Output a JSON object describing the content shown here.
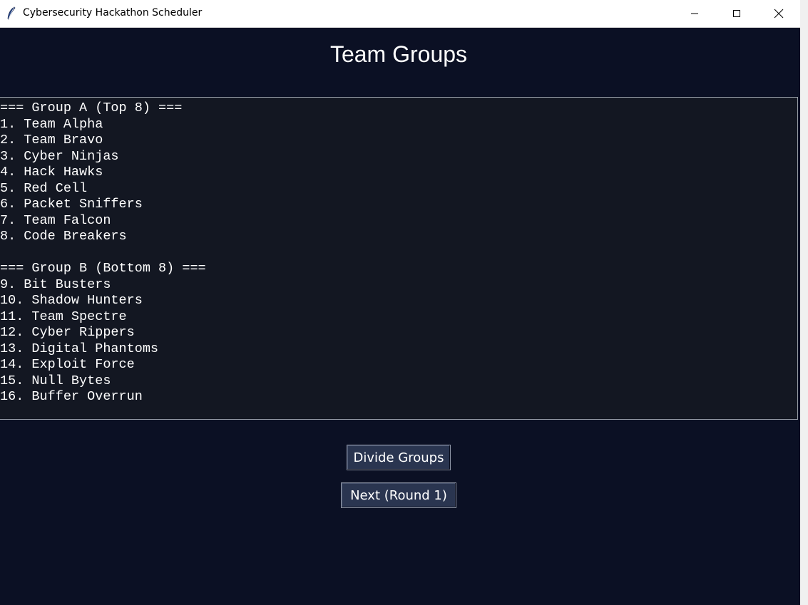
{
  "window": {
    "title": "Cybersecurity Hackathon Scheduler",
    "icon": "feather-icon",
    "controls": [
      "minimize-icon",
      "maximize-icon",
      "close-icon"
    ]
  },
  "header": {
    "title": "Team Groups"
  },
  "groups_text": {
    "lines": [
      "=== Group A (Top 8) ===",
      "1. Team Alpha",
      "2. Team Bravo",
      "3. Cyber Ninjas",
      "4. Hack Hawks",
      "5. Red Cell",
      "6. Packet Sniffers",
      "7. Team Falcon",
      "8. Code Breakers",
      "",
      "=== Group B (Bottom 8) ===",
      "9. Bit Busters",
      "10. Shadow Hunters",
      "11. Team Spectre",
      "12. Cyber Rippers",
      "13. Digital Phantoms",
      "14. Exploit Force",
      "15. Null Bytes",
      "16. Buffer Overrun"
    ]
  },
  "actions": {
    "divide_label": "Divide Groups",
    "next_label": "Next (Round 1)"
  },
  "colors": {
    "background": "#0b1024",
    "panel": "#131722",
    "button": "#2a3550",
    "text": "#ffffff"
  }
}
